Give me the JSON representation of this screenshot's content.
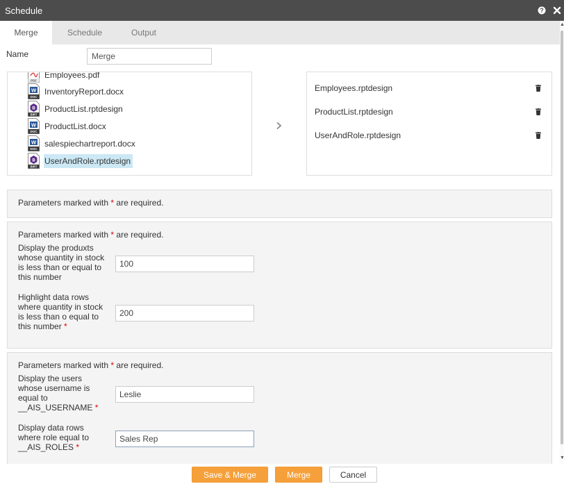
{
  "window": {
    "title": "Schedule"
  },
  "tabs": [
    {
      "label": "Merge"
    },
    {
      "label": "Schedule"
    },
    {
      "label": "Output"
    }
  ],
  "name_field": {
    "label": "Name",
    "value": "Merge"
  },
  "file_list": {
    "items": [
      {
        "name": "Employees.pdf",
        "type": "PDF"
      },
      {
        "name": "InventoryReport.docx",
        "type": "DOC"
      },
      {
        "name": "ProductList.rptdesign",
        "type": "BIRT"
      },
      {
        "name": "ProductList.docx",
        "type": "DOC"
      },
      {
        "name": "salespiechartreport.docx",
        "type": "DOC"
      },
      {
        "name": "UserAndRole.rptdesign",
        "type": "BIRT"
      }
    ]
  },
  "selected_list": {
    "items": [
      {
        "name": "Employees.rptdesign"
      },
      {
        "name": "ProductList.rptdesign"
      },
      {
        "name": "UserAndRole.rptdesign"
      }
    ]
  },
  "params": {
    "required_prefix": "Parameters marked with",
    "required_star": "*",
    "required_suffix": "are required.",
    "group2": {
      "p1_label": "Display the produxts whose quantity in stock is less than or equal to this number",
      "p1_value": "100",
      "p2_label": "Highlight data rows where quantity in stock is less than o equal to this number",
      "p2_value": "200"
    },
    "group3": {
      "p1_label": "Display the users whose username is equal to __AIS_USERNAME",
      "p1_value": "Leslie",
      "p2_label": "Display data rows where role equal to __AIS_ROLES",
      "p2_value": "Sales Rep"
    }
  },
  "buttons": {
    "save_merge": "Save & Merge",
    "merge": "Merge",
    "cancel": "Cancel"
  },
  "colors": {
    "titlebar": "#4c4c4c",
    "primary_button": "#f5a03a",
    "selected_row": "#cce8f5",
    "required_star": "#dd0000"
  }
}
